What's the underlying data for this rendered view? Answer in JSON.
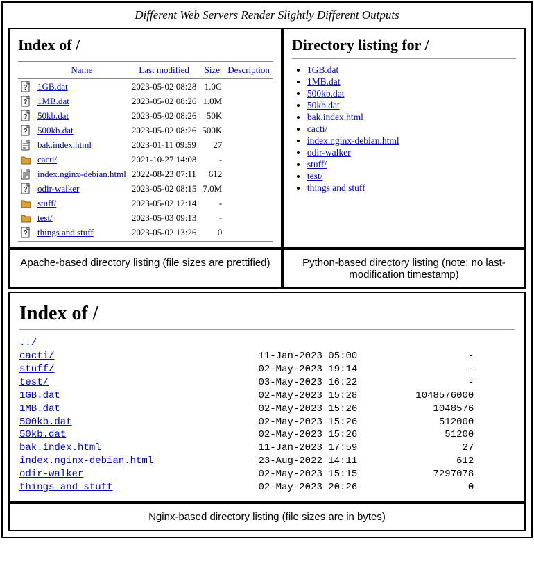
{
  "figure_title": "Different Web Servers Render Slightly Different Outputs",
  "apache": {
    "heading": "Index of /",
    "columns": {
      "name": "Name",
      "modified": "Last modified",
      "size": "Size",
      "desc": "Description"
    },
    "caption": "Apache-based directory listing (file sizes are prettified)",
    "rows": [
      {
        "icon": "unknown",
        "name": "1GB.dat",
        "modified": "2023-05-02 08:28",
        "size": "1.0G"
      },
      {
        "icon": "unknown",
        "name": "1MB.dat",
        "modified": "2023-05-02 08:26",
        "size": "1.0M"
      },
      {
        "icon": "unknown",
        "name": "50kb.dat",
        "modified": "2023-05-02 08:26",
        "size": "50K"
      },
      {
        "icon": "unknown",
        "name": "500kb.dat",
        "modified": "2023-05-02 08:26",
        "size": "500K"
      },
      {
        "icon": "text",
        "name": "bak.index.html",
        "modified": "2023-01-11 09:59",
        "size": "27"
      },
      {
        "icon": "folder",
        "name": "cacti/",
        "modified": "2021-10-27 14:08",
        "size": "-"
      },
      {
        "icon": "text",
        "name": "index.nginx-debian.html",
        "modified": "2022-08-23 07:11",
        "size": "612"
      },
      {
        "icon": "unknown",
        "name": "odir-walker",
        "modified": "2023-05-02 08:15",
        "size": "7.0M"
      },
      {
        "icon": "folder",
        "name": "stuff/",
        "modified": "2023-05-02 12:14",
        "size": "-"
      },
      {
        "icon": "folder",
        "name": "test/",
        "modified": "2023-05-03 09:13",
        "size": "-"
      },
      {
        "icon": "unknown",
        "name": "things and stuff",
        "modified": "2023-05-02 13:26",
        "size": "0"
      }
    ]
  },
  "python": {
    "heading": "Directory listing for /",
    "caption": "Python-based directory listing (note: no last-modification timestamp)",
    "items": [
      "1GB.dat",
      "1MB.dat",
      "500kb.dat",
      "50kb.dat",
      "bak.index.html",
      "cacti/",
      "index.nginx-debian.html",
      "odir-walker",
      "stuff/",
      "test/",
      "things and stuff"
    ]
  },
  "nginx": {
    "heading": "Index of /",
    "caption": "Nginx-based directory listing (file sizes are in bytes)",
    "parent": "../",
    "rows": [
      {
        "name": "cacti/",
        "modified": "11-Jan-2023 05:00",
        "size": "-"
      },
      {
        "name": "stuff/",
        "modified": "02-May-2023 19:14",
        "size": "-"
      },
      {
        "name": "test/",
        "modified": "03-May-2023 16:22",
        "size": "-"
      },
      {
        "name": "1GB.dat",
        "modified": "02-May-2023 15:28",
        "size": "1048576000"
      },
      {
        "name": "1MB.dat",
        "modified": "02-May-2023 15:26",
        "size": "1048576"
      },
      {
        "name": "500kb.dat",
        "modified": "02-May-2023 15:26",
        "size": "512000"
      },
      {
        "name": "50kb.dat",
        "modified": "02-May-2023 15:26",
        "size": "51200"
      },
      {
        "name": "bak.index.html",
        "modified": "11-Jan-2023 17:59",
        "size": "27"
      },
      {
        "name": "index.nginx-debian.html",
        "modified": "23-Aug-2022 14:11",
        "size": "612"
      },
      {
        "name": "odir-walker",
        "modified": "02-May-2023 15:15",
        "size": "7297078"
      },
      {
        "name": "things and stuff",
        "modified": "02-May-2023 20:26",
        "size": "0"
      }
    ],
    "name_col_width": 41,
    "date_col_width": 18,
    "size_col_width": 19
  }
}
